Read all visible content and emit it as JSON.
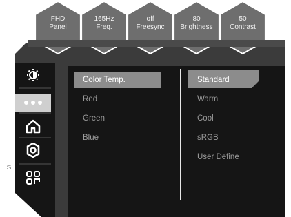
{
  "top_tabs": [
    {
      "line1": "FHD",
      "line2": "Panel"
    },
    {
      "line1": "165Hz",
      "line2": "Freq."
    },
    {
      "line1": "off",
      "line2": "Freesync"
    },
    {
      "line1": "80",
      "line2": "Brightness"
    },
    {
      "line1": "50",
      "line2": "Contrast"
    }
  ],
  "sidebar": {
    "icons": [
      {
        "name": "brightness-icon",
        "selected": false
      },
      {
        "name": "more-dots-icon",
        "selected": true
      },
      {
        "name": "home-icon",
        "selected": false
      },
      {
        "name": "settings-gear-icon",
        "selected": false
      },
      {
        "name": "grid-apps-icon",
        "selected": false
      }
    ]
  },
  "menu": {
    "items": [
      "Color Temp.",
      "Red",
      "Green",
      "Blue"
    ],
    "active_index": 0
  },
  "submenu": {
    "items": [
      "Standard",
      "Warm",
      "Cool",
      "sRGB",
      "User Define"
    ],
    "active_index": 0
  },
  "stray_text": "s",
  "colors": {
    "frame_outer": "#3b3b3b",
    "panel_dark": "#151515",
    "hex_tab": "#6e6e6e",
    "highlight": "#8c8c8c",
    "selected_icon_bg": "#cfcfcf",
    "inactive_text": "#9a9a9a"
  }
}
